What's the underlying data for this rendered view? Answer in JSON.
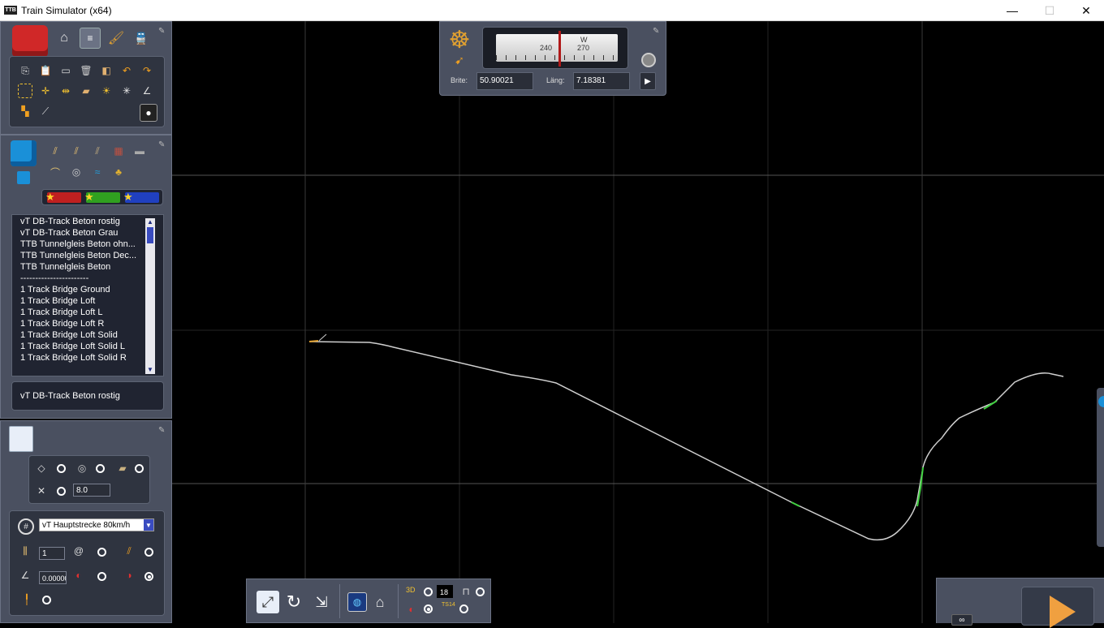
{
  "window": {
    "title": "Train Simulator (x64)",
    "app_icon_text": "TTB",
    "minimize_glyph": "—",
    "maximize_glyph": "☐",
    "close_glyph": "✕"
  },
  "navigator": {
    "compass_label_w": "W",
    "compass_tick_240": "240",
    "compass_tick_270": "270",
    "lat_label": "Brite:",
    "lat_value": "50.90021",
    "lon_label": "Läng:",
    "lon_value": "7.18381"
  },
  "asset_list": {
    "items": [
      "vT DB-Track Beton rostig",
      "vT DB-Track Beton Grau",
      "TTB Tunnelgleis Beton ohn...",
      "TTB Tunnelgleis Beton Dec...",
      "TTB Tunnelgleis Beton",
      "-----------------------",
      "1 Track Bridge Ground",
      "1 Track Bridge Loft",
      "1 Track Bridge Loft L",
      "1 Track Bridge Loft R",
      "1 Track Bridge Loft Solid",
      "1 Track Bridge Loft Solid L",
      "1 Track Bridge Loft Solid R"
    ],
    "selected": "vT DB-Track Beton rostig"
  },
  "track_options": {
    "width_value": "8.0"
  },
  "track_rules": {
    "rule_select": "vT Hauptstrecke 80km/h",
    "track_count_value": "1",
    "gradient_value": "0.00000"
  },
  "bottom_bar": {
    "counter_value": "18",
    "label_3d": "3D",
    "label_ts14": "TS14"
  },
  "colors": {
    "panel": "#4a5060",
    "panel_inset": "#2f3440",
    "track": "#cfcfcf",
    "grid": "#2a2a2a",
    "play_orange": "#f0a040"
  }
}
